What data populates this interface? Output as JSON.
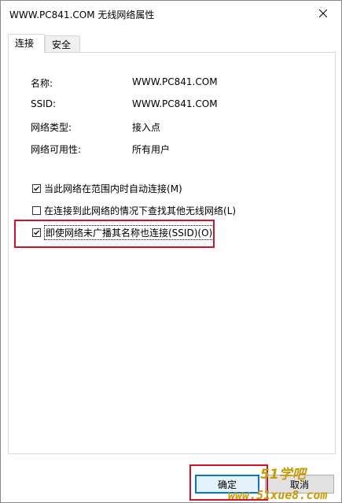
{
  "window": {
    "title": "WWW.PC841.COM 无线网络属性"
  },
  "tabs": [
    {
      "label": "连接",
      "active": true
    },
    {
      "label": "安全",
      "active": false
    }
  ],
  "properties": [
    {
      "label": "名称:",
      "value": "WWW.PC841.COM"
    },
    {
      "label": "SSID:",
      "value": "WWW.PC841.COM"
    },
    {
      "label": "网络类型:",
      "value": "接入点"
    },
    {
      "label": "网络可用性:",
      "value": "所有用户"
    }
  ],
  "options": [
    {
      "text": "当此网络在范围内时自动连接",
      "key": "(M)",
      "checked": true
    },
    {
      "text": "在连接到此网络的情况下查找其他无线网络",
      "key": "(L)",
      "checked": false
    },
    {
      "text": "即使网络未广播其名称也连接(SSID)",
      "key": "(O)",
      "checked": true
    }
  ],
  "buttons": {
    "ok": "确定",
    "cancel": "取消"
  },
  "watermark": {
    "line1": "51学吧",
    "line2": "www.51xue8.com"
  },
  "colors": {
    "highlight": "#d0122e",
    "accent": "#0078d7",
    "watermark": "#c99a00"
  }
}
